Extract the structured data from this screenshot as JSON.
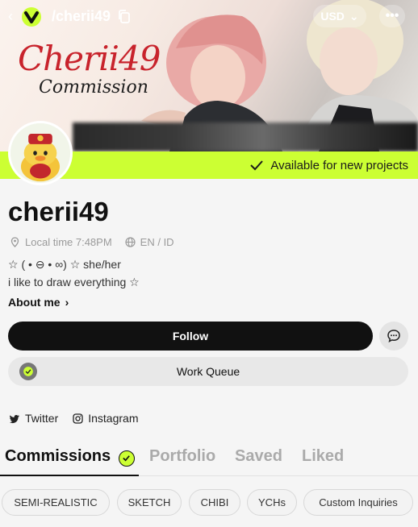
{
  "header": {
    "handle": "/cherii49",
    "currency": "USD",
    "banner_title": "Cherii49",
    "banner_subtitle": "Commission"
  },
  "availability": {
    "label": "Available for new projects"
  },
  "profile": {
    "name": "cherii49",
    "local_time_label": "Local time 7:48PM",
    "languages": "EN / ID",
    "bio_line1": "☆ ( • ⊖ • ∞) ☆ she/her",
    "bio_line2": "i like to draw everything ☆",
    "about_label": "About me"
  },
  "actions": {
    "follow_label": "Follow",
    "work_queue_label": "Work Queue"
  },
  "socials": [
    {
      "label": "Twitter",
      "icon": "twitter-icon"
    },
    {
      "label": "Instagram",
      "icon": "instagram-icon"
    }
  ],
  "tabs": [
    {
      "label": "Commissions",
      "active": true
    },
    {
      "label": "Portfolio",
      "active": false
    },
    {
      "label": "Saved",
      "active": false
    },
    {
      "label": "Liked",
      "active": false
    }
  ],
  "filters": [
    "SEMI-REALISTIC",
    "SKETCH",
    "CHIBI",
    "YCHs",
    "Custom Inquiries"
  ],
  "colors": {
    "accent": "#ccff33",
    "banner_text": "#c8232c",
    "button_dark": "#111111"
  }
}
